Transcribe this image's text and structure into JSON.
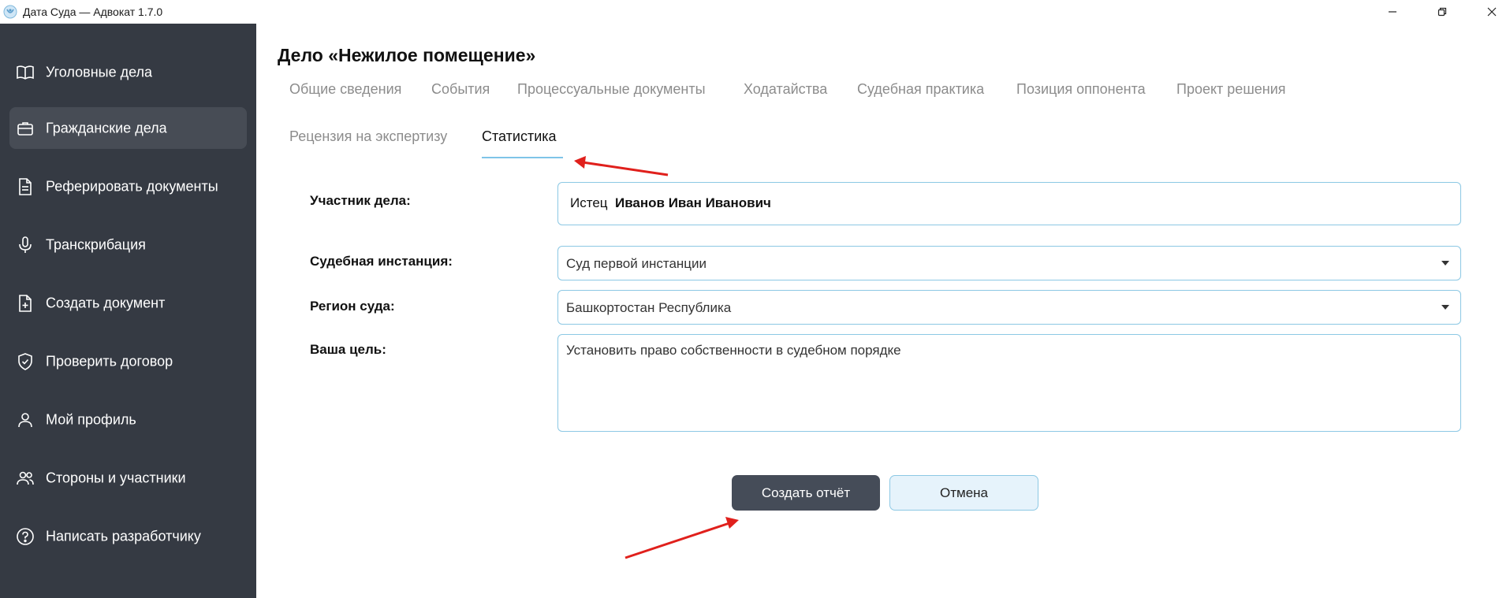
{
  "window": {
    "title": "Дата Суда — Адвокат 1.7.0",
    "controls": [
      "minimize-icon",
      "restore-icon",
      "close-icon"
    ]
  },
  "sidebar": {
    "items": [
      {
        "label": "Уголовные дела",
        "icon": "book-icon",
        "active": false
      },
      {
        "label": "Гражданские дела",
        "icon": "briefcase-icon",
        "active": true
      },
      {
        "label": "Реферировать документы",
        "icon": "document-lines-icon",
        "active": false
      },
      {
        "label": "Транскрибация",
        "icon": "microphone-icon",
        "active": false
      },
      {
        "label": "Создать документ",
        "icon": "document-plus-icon",
        "active": false
      },
      {
        "label": "Проверить договор",
        "icon": "shield-check-icon",
        "active": false
      },
      {
        "label": "Мой профиль",
        "icon": "user-icon",
        "active": false
      },
      {
        "label": "Стороны и участники",
        "icon": "users-icon",
        "active": false
      },
      {
        "label": "Написать разработчику",
        "icon": "question-circle-icon",
        "active": false
      }
    ]
  },
  "main": {
    "case_title": "Дело «Нежилое помещение»",
    "tabs_row1": [
      "Общие сведения",
      "События",
      "Процессуальные документы",
      "Ходатайства",
      "Судебная практика",
      "Позиция оппонента",
      "Проект решения"
    ],
    "tabs_row2": [
      "Рецензия на экспертизу",
      "Статистика"
    ],
    "active_tab": "Статистика",
    "form": {
      "participant_label": "Участник дела:",
      "participant_role": "Истец",
      "participant_name": "Иванов Иван Иванович",
      "instance_label": "Судебная инстанция:",
      "instance_value": "Суд первой инстанции",
      "region_label": "Регион суда:",
      "region_value": "Башкортостан Республика",
      "goal_label": "Ваша цель:",
      "goal_value": "Установить право собственности в судебном порядке"
    },
    "buttons": {
      "create_report": "Создать отчёт",
      "cancel": "Отмена"
    }
  },
  "colors": {
    "sidebar_bg": "#353a43",
    "sidebar_active_bg": "#474c55",
    "accent": "#7fc4e8",
    "primary_button": "#454c58",
    "secondary_button": "#e6f3fb",
    "annotation_arrow": "#e0201c"
  }
}
